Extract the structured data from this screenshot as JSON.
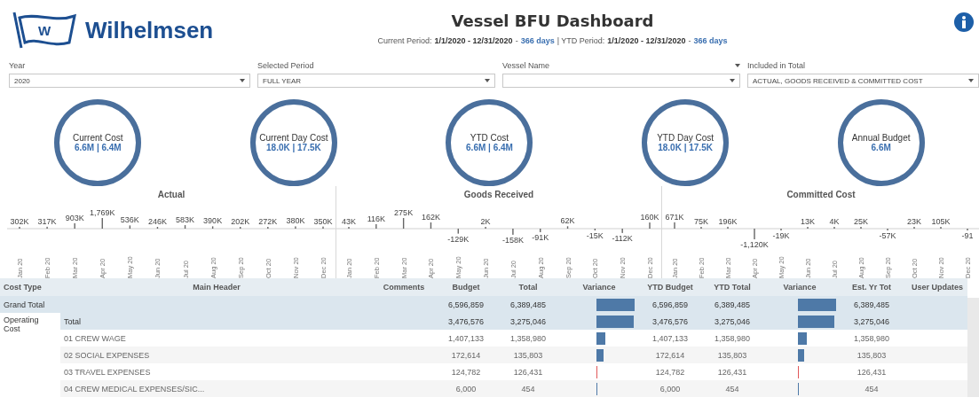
{
  "header": {
    "logo": {
      "mark": "W",
      "name": "Wilhelmsen"
    },
    "title": "Vessel BFU Dashboard",
    "subtitle": [
      {
        "kind": "text",
        "text": "Current Period:"
      },
      {
        "kind": "date",
        "text": "1/1/2020 - 12/31/2020"
      },
      {
        "kind": "text",
        "text": "-"
      },
      {
        "kind": "days",
        "text": "366 days"
      },
      {
        "kind": "text",
        "text": "| YTD Period:"
      },
      {
        "kind": "date",
        "text": "1/1/2020 - 12/31/2020"
      },
      {
        "kind": "text",
        "text": "-"
      },
      {
        "kind": "days",
        "text": "366 days"
      }
    ]
  },
  "filters": [
    {
      "label": "Year",
      "value": "2020",
      "label_menu": false
    },
    {
      "label": "Selected Period",
      "value": "FULL YEAR",
      "label_menu": false
    },
    {
      "label": "Vessel Name",
      "label_menu": true
    },
    {
      "label": "Included in Total",
      "value": "ACTUAL, GOODS RECEIVED & COMMITTED COST",
      "label_menu": false
    }
  ],
  "kpis": [
    {
      "title": "Current Cost",
      "value": "6.6M | 6.4M"
    },
    {
      "title": "Current Day Cost",
      "value": "18.0K | 17.5K"
    },
    {
      "title": "YTD Cost",
      "value": "6.6M | 6.4M"
    },
    {
      "title": "YTD Day Cost",
      "value": "18.0K | 17.5K"
    },
    {
      "title": "Annual Budget",
      "value": "6.6M"
    }
  ],
  "monthly_charts": [
    {
      "chart_data": {
        "type": "bar",
        "title": "Actual",
        "categories": [
          "Jan 20",
          "Feb 20",
          "Mar 20",
          "Apr 20",
          "May 20",
          "Jun 20",
          "Jul 20",
          "Aug 20",
          "Sep 20",
          "Oct 20",
          "Nov 20",
          "Dec 20"
        ],
        "values": [
          302,
          317,
          903,
          1769,
          536,
          246,
          583,
          390,
          202,
          272,
          380,
          350
        ],
        "value_labels": [
          "302K",
          "317K",
          "903K",
          "1,769K",
          "536K",
          "246K",
          "583K",
          "390K",
          "202K",
          "272K",
          "380K",
          "350K"
        ]
      }
    },
    {
      "chart_data": {
        "type": "bar",
        "title": "Goods Received",
        "categories": [
          "Jan 20",
          "Feb 20",
          "Mar 20",
          "Apr 20",
          "May 20",
          "Jun 20",
          "Jul 20",
          "Aug 20",
          "Sep 20",
          "Oct 20",
          "Nov 20",
          "Dec 20"
        ],
        "values": [
          43,
          116,
          275,
          162,
          -129,
          2,
          -158,
          -91,
          62,
          -15,
          -112,
          160
        ],
        "value_labels": [
          "43K",
          "116K",
          "275K",
          "162K",
          "-129K",
          "2K",
          "-158K",
          "-91K",
          "62K",
          "-15K",
          "-112K",
          "160K"
        ]
      }
    },
    {
      "chart_data": {
        "type": "bar",
        "title": "Committed Cost",
        "categories": [
          "Jan 20",
          "Feb 20",
          "Mar 20",
          "Apr 20",
          "May 20",
          "Jun 20",
          "Jul 20",
          "Aug 20",
          "Sep 20",
          "Oct 20",
          "Nov 20",
          "Dec 20"
        ],
        "values": [
          671,
          75,
          196,
          -1120,
          -19,
          13,
          4,
          25,
          -57,
          23,
          105,
          -91
        ],
        "value_labels": [
          "671K",
          "75K",
          "196K",
          "-1,120K",
          "-19K",
          "13K",
          "4K",
          "25K",
          "-57K",
          "23K",
          "105K",
          "-91"
        ]
      }
    }
  ],
  "table": {
    "columns": [
      "Cost Type",
      "Main Header",
      "Comments",
      "Budget",
      "Total",
      "Variance",
      "YTD Budget",
      "YTD Total",
      "Variance",
      "Est. Yr Tot",
      "User Updates"
    ],
    "rows": [
      {
        "kind": "grand",
        "cost_type": "Grand Total",
        "budget": "6,596,859",
        "total": "6,389,485",
        "ytd_budget": "6,596,859",
        "ytd_total": "6,389,485",
        "est_yr_tot": "6,389,485"
      },
      {
        "kind": "total",
        "cost_type": "Operating Cost",
        "main_header": "Total",
        "budget": "3,476,576",
        "total": "3,275,046",
        "ytd_budget": "3,476,576",
        "ytd_total": "3,275,046",
        "est_yr_tot": "3,275,046"
      },
      {
        "kind": "item",
        "main_header": "01 CREW WAGE",
        "budget": "1,407,133",
        "total": "1,358,980",
        "ytd_budget": "1,407,133",
        "ytd_total": "1,358,980",
        "est_yr_tot": "1,358,980"
      },
      {
        "kind": "item",
        "main_header": "02 SOCIAL EXPENSES",
        "budget": "172,614",
        "total": "135,803",
        "ytd_budget": "172,614",
        "ytd_total": "135,803",
        "est_yr_tot": "135,803"
      },
      {
        "kind": "item",
        "main_header": "03 TRAVEL EXPENSES",
        "budget": "124,782",
        "total": "126,431",
        "ytd_budget": "124,782",
        "ytd_total": "126,431",
        "est_yr_tot": "126,431"
      },
      {
        "kind": "item",
        "main_header": "04 CREW MEDICAL EXPENSES/SIC...",
        "budget": "6,000",
        "total": "454",
        "ytd_budget": "6,000",
        "ytd_total": "454",
        "est_yr_tot": "454"
      }
    ]
  }
}
